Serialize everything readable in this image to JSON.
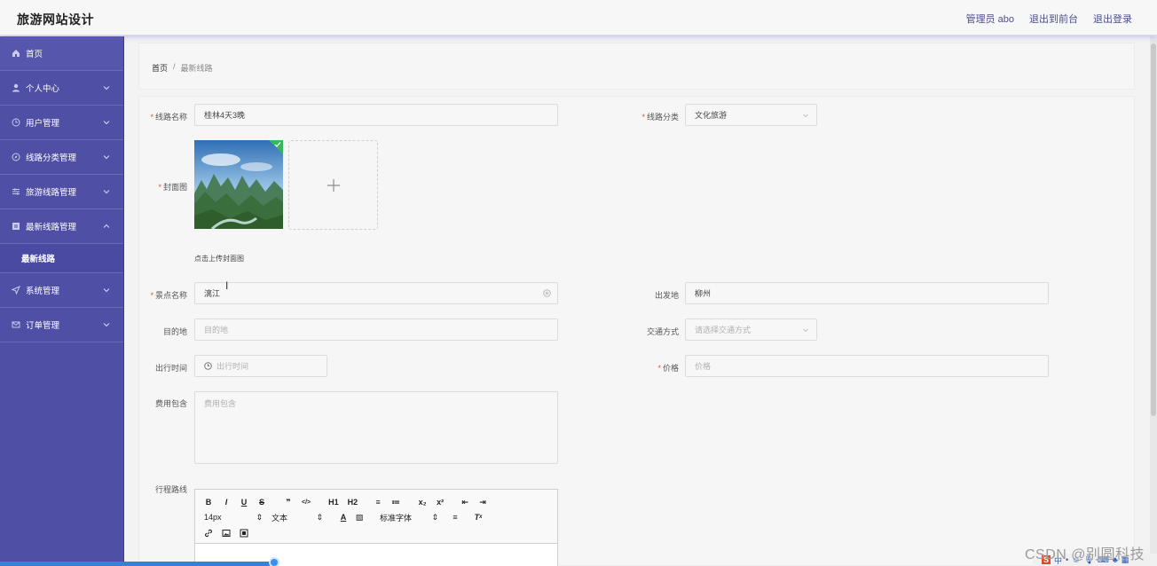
{
  "app": {
    "title": "旅游网站设计"
  },
  "header": {
    "user": "管理员 abo",
    "front": "退出到前台",
    "logout": "退出登录"
  },
  "sidebar": {
    "items": [
      {
        "label": "首页",
        "icon": "home-icon"
      },
      {
        "label": "个人中心",
        "icon": "user-icon"
      },
      {
        "label": "用户管理",
        "icon": "clock-icon"
      },
      {
        "label": "线路分类管理",
        "icon": "compass-icon"
      },
      {
        "label": "旅游线路管理",
        "icon": "sliders-icon"
      },
      {
        "label": "最新线路管理",
        "icon": "file-icon",
        "expanded": true,
        "children": [
          "最新线路"
        ]
      },
      {
        "label": "系统管理",
        "icon": "send-icon"
      },
      {
        "label": "订单管理",
        "icon": "mail-icon"
      }
    ]
  },
  "breadcrumb": {
    "home": "首页",
    "separator": "/",
    "current": "最新线路"
  },
  "form": {
    "route_name": {
      "label": "线路名称",
      "value": "桂林4天3晚"
    },
    "category": {
      "label": "线路分类",
      "value": "文化旅游"
    },
    "cover": {
      "label": "封面图",
      "tip": "点击上传封面图"
    },
    "spot": {
      "label": "景点名称",
      "value": "漓江"
    },
    "departure": {
      "label": "出发地",
      "value": "柳州"
    },
    "destination": {
      "label": "目的地",
      "placeholder": "目的地"
    },
    "transport": {
      "label": "交通方式",
      "placeholder": "请选择交通方式"
    },
    "time": {
      "label": "出行时间",
      "placeholder": "出行时间"
    },
    "price": {
      "label": "价格",
      "placeholder": "价格"
    },
    "fees": {
      "label": "费用包含",
      "placeholder": "费用包含"
    },
    "itinerary": {
      "label": "行程路线"
    }
  },
  "editor": {
    "row1": [
      "B",
      "I",
      "U",
      "S",
      "❞",
      "</>",
      "H1",
      "H2",
      "≡",
      "≔",
      "x₂",
      "x²",
      "⇤",
      "⇥"
    ],
    "font_size": "14px",
    "text_type": "文本",
    "font_family": "标准字体"
  },
  "watermark": "CSDN @别圆科技",
  "colors": {
    "sidebar": "#4f4fa6",
    "required": "#e74c3c",
    "accent": "#3a7fd6"
  }
}
